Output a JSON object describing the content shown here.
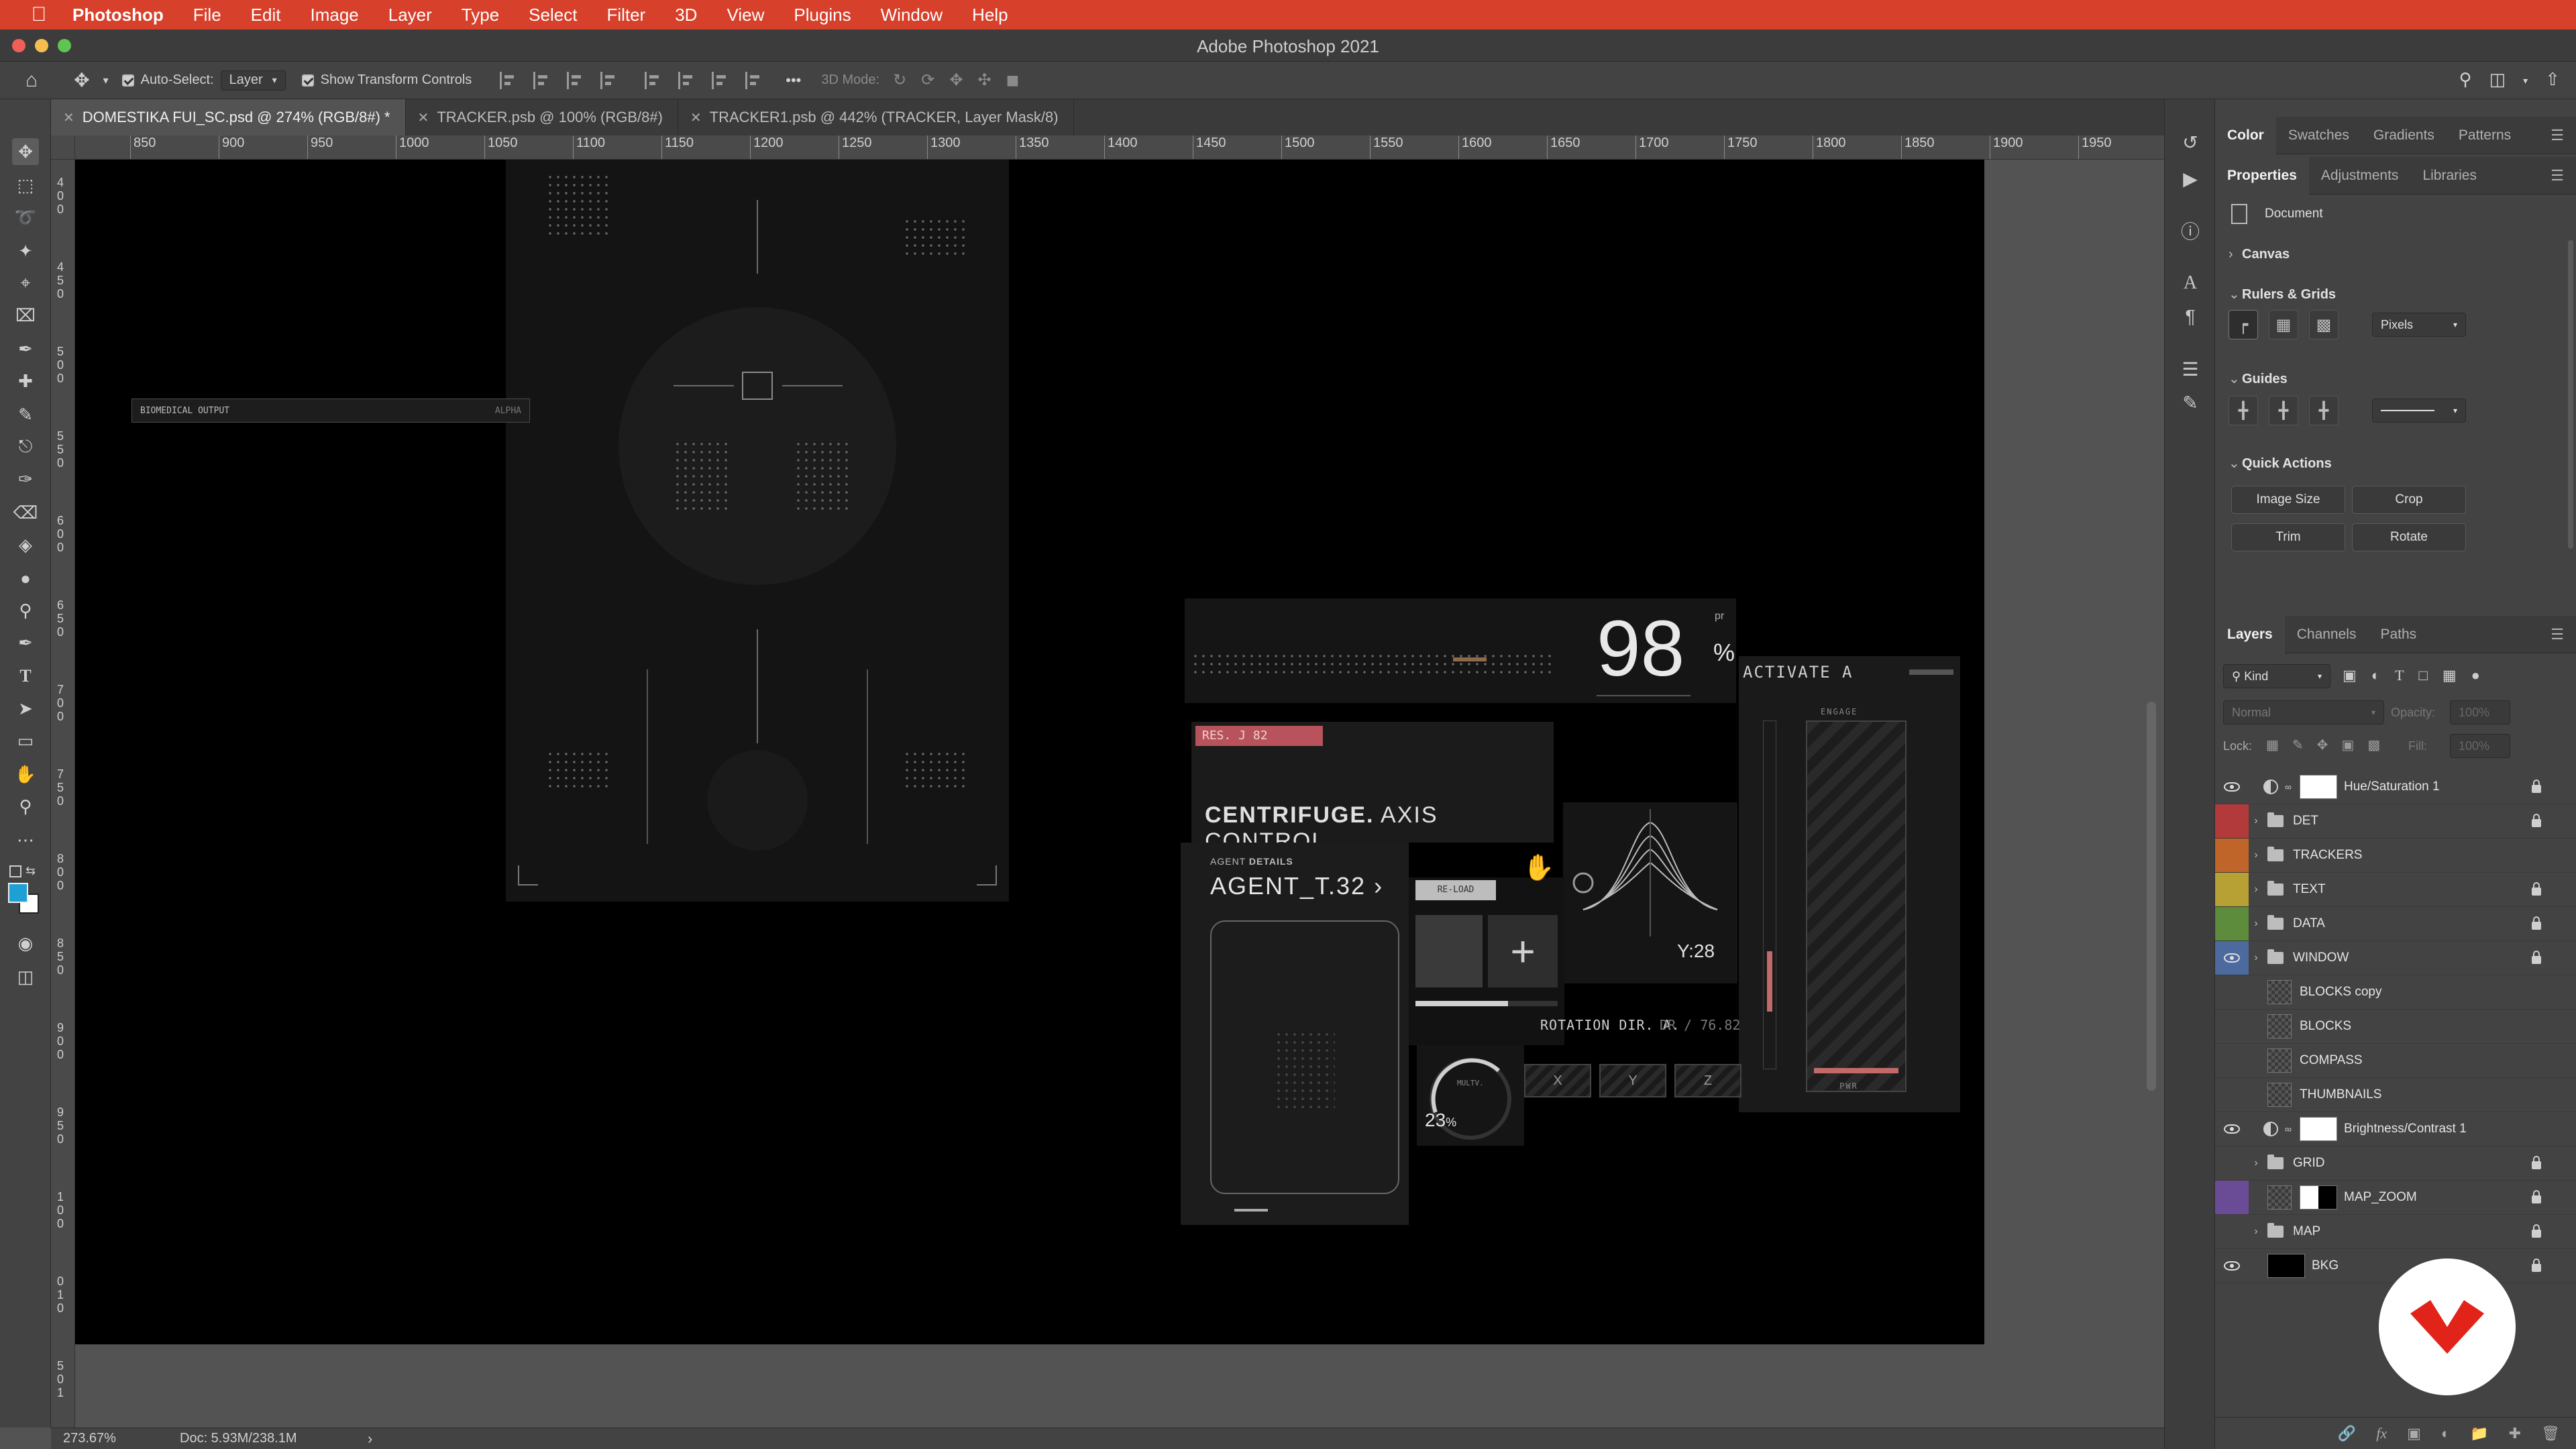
{
  "menubar": {
    "app": "Photoshop",
    "items": [
      "File",
      "Edit",
      "Image",
      "Layer",
      "Type",
      "Select",
      "Filter",
      "3D",
      "View",
      "Plugins",
      "Window",
      "Help"
    ]
  },
  "window": {
    "title": "Adobe Photoshop 2021"
  },
  "options": {
    "auto_select_label": "Auto-Select:",
    "auto_select_value": "Layer",
    "transform_label": "Show Transform Controls",
    "mode_3d_label": "3D Mode:",
    "more": "•••"
  },
  "tabs": [
    {
      "label": "DOMESTIKA FUI_SC.psd @ 274% (RGB/8#) *",
      "active": true
    },
    {
      "label": "TRACKER.psb @ 100% (RGB/8#)",
      "active": false
    },
    {
      "label": "TRACKER1.psb @ 442% (TRACKER, Layer Mask/8)",
      "active": false
    }
  ],
  "ruler": {
    "h_labels": [
      "850",
      "900",
      "950",
      "1000",
      "1050",
      "1100",
      "1150",
      "1200",
      "1250",
      "1300",
      "1350",
      "1400",
      "1450",
      "1500",
      "1550",
      "1600",
      "1650",
      "1700",
      "1750",
      "1800",
      "1850",
      "1900",
      "1950",
      "20"
    ],
    "v_labels": [
      "4",
      "0",
      "0",
      "4",
      "5",
      "0",
      "5",
      "0",
      "0",
      "5",
      "5",
      "0",
      "6",
      "0",
      "0",
      "6",
      "5",
      "0",
      "7",
      "0",
      "0",
      "7",
      "5",
      "0",
      "8",
      "0",
      "0",
      "8",
      "5",
      "0",
      "9",
      "0",
      "0",
      "9",
      "5",
      "0",
      "1",
      "0",
      "0",
      "0",
      "1",
      "0",
      "5",
      "0",
      "1",
      "1"
    ]
  },
  "status": {
    "zoom": "273.67%",
    "doc": "Doc: 5.93M/238.1M",
    "arrow": "›"
  },
  "hud": {
    "biomedical": "BIOMEDICAL OUTPUT",
    "alpha": "ALPHA",
    "percent_value": "98",
    "percent_unit": "%",
    "percent_sup": "pr",
    "activate": "ACTIVATE A",
    "res": "RES. J 82",
    "centrifuge": "CENTRIFUGE.",
    "axis_control": "AXIS CONTROL",
    "agent_details_a": "AGENT",
    "agent_details_b": "DETAILS",
    "agent_name": "AGENT_T.32 ›",
    "reload": "RE-LOAD",
    "y_value": "Y:28",
    "rotation": "ROTATION DIR. A.",
    "rotation_val": "DR / 76.82",
    "gauge_pct": "23",
    "gauge_unit": "%",
    "gauge_label": "MULTV.",
    "axes": [
      "X",
      "Y",
      "Z"
    ],
    "engage": "ENGAGE",
    "pwr": "PWR"
  },
  "panels": {
    "top_tabs": [
      "Color",
      "Swatches",
      "Gradients",
      "Patterns"
    ],
    "prop_tabs": [
      "Properties",
      "Adjustments",
      "Libraries"
    ],
    "document_label": "Document",
    "canvas": "Canvas",
    "rulers_grids": "Rulers & Grids",
    "units": "Pixels",
    "guides": "Guides",
    "quick_actions": "Quick Actions",
    "qa_buttons": [
      "Image Size",
      "Crop",
      "Trim",
      "Rotate"
    ],
    "layer_tabs": [
      "Layers",
      "Channels",
      "Paths"
    ],
    "kind": "Kind",
    "blend": "Normal",
    "opacity_label": "Opacity:",
    "opacity_value": "100%",
    "lock_label": "Lock:",
    "fill_label": "Fill:",
    "fill_value": "100%"
  },
  "layers": [
    {
      "name": "Hue/Saturation 1",
      "type": "adjust",
      "visible": true,
      "color": "",
      "locked": true
    },
    {
      "name": "DET",
      "type": "group",
      "visible": false,
      "color": "#b33a3a",
      "locked": true
    },
    {
      "name": "TRACKERS",
      "type": "group",
      "visible": false,
      "color": "#c0652a",
      "locked": false
    },
    {
      "name": "TEXT",
      "type": "group",
      "visible": false,
      "color": "#b8a134",
      "locked": true
    },
    {
      "name": "DATA",
      "type": "group",
      "visible": false,
      "color": "#5c8c3c",
      "locked": true
    },
    {
      "name": "WINDOW",
      "type": "group",
      "visible": true,
      "color": "#4c6a9e",
      "locked": true
    },
    {
      "name": "BLOCKS copy",
      "type": "smart",
      "visible": false,
      "color": "",
      "locked": false
    },
    {
      "name": "BLOCKS",
      "type": "smart",
      "visible": false,
      "color": "",
      "locked": false
    },
    {
      "name": "COMPASS",
      "type": "smart",
      "visible": false,
      "color": "",
      "locked": false
    },
    {
      "name": "THUMBNAILS",
      "type": "smart",
      "visible": false,
      "color": "",
      "locked": false
    },
    {
      "name": "Brightness/Contrast 1",
      "type": "adjust",
      "visible": true,
      "color": "",
      "locked": false
    },
    {
      "name": "GRID",
      "type": "group",
      "visible": false,
      "color": "",
      "locked": true
    },
    {
      "name": "MAP_ZOOM",
      "type": "mask",
      "visible": false,
      "color": "#6a4c96",
      "locked": true
    },
    {
      "name": "MAP",
      "type": "group",
      "visible": false,
      "color": "",
      "locked": true
    },
    {
      "name": "BKG",
      "type": "fill",
      "visible": true,
      "color": "",
      "locked": true
    }
  ]
}
